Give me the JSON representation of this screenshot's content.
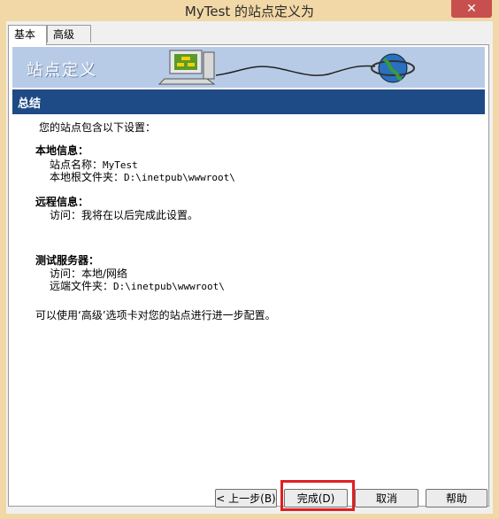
{
  "window": {
    "title": "MyTest 的站点定义为",
    "close_glyph": "✕"
  },
  "tabs": [
    {
      "label": "基本",
      "active": true
    },
    {
      "label": "高级",
      "active": false
    }
  ],
  "banner": {
    "title": "站点定义"
  },
  "section": {
    "title": "总结"
  },
  "summary": {
    "intro": "您的站点包含以下设置：",
    "local": {
      "heading": "本地信息：",
      "site_name_label": "站点名称：",
      "site_name_value": "MyTest",
      "root_label": "本地根文件夹：",
      "root_value": "D:\\inetpub\\wwwroot\\"
    },
    "remote": {
      "heading": "远程信息：",
      "access": "访问：我将在以后完成此设置。"
    },
    "testing": {
      "heading": "测试服务器：",
      "access": "访问：本地/网络",
      "remote_folder_label": "远端文件夹：",
      "remote_folder_value": "D:\\inetpub\\wwwroot\\"
    },
    "footer": "可以使用‘高级’选项卡对您的站点进行进一步配置。"
  },
  "buttons": {
    "back": "< 上一步(B)",
    "finish": "完成(D)",
    "cancel": "取消",
    "help": "帮助"
  },
  "colors": {
    "title_bar": "#f2d8a6",
    "banner": "#b8cbe6",
    "section_bar": "#1e4b86",
    "highlight": "#e02020"
  }
}
